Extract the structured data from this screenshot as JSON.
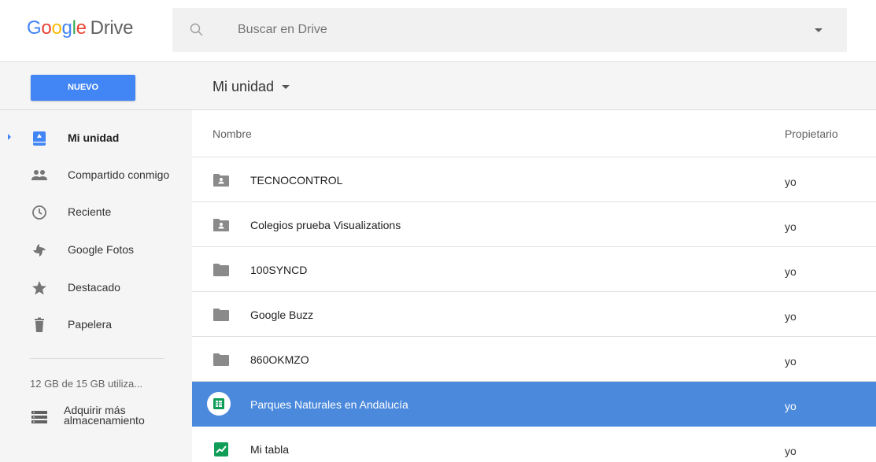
{
  "header": {
    "logo": {
      "g1": "G",
      "o1": "o",
      "o2": "o",
      "g2": "g",
      "l": "l",
      "e": "e",
      "product": "Drive"
    },
    "search_placeholder": "Buscar en Drive"
  },
  "toolbar": {
    "new_label": "NUEVO",
    "breadcrumb": "Mi unidad"
  },
  "sidebar": {
    "items": [
      {
        "label": "Mi unidad",
        "icon": "my-drive-icon",
        "active": true
      },
      {
        "label": "Compartido conmigo",
        "icon": "shared-people-icon"
      },
      {
        "label": "Reciente",
        "icon": "clock-icon"
      },
      {
        "label": "Google Fotos",
        "icon": "photos-pinwheel-icon"
      },
      {
        "label": "Destacado",
        "icon": "star-icon"
      },
      {
        "label": "Papelera",
        "icon": "trash-icon"
      }
    ],
    "storage_text": "12 GB de 15 GB utiliza...",
    "buy_storage_line1": "Adquirir más",
    "buy_storage_line2": "almacenamiento"
  },
  "list": {
    "columns": {
      "name": "Nombre",
      "owner": "Propietario"
    },
    "rows": [
      {
        "name": "TECNOCONTROL",
        "owner": "yo",
        "icon": "shared-folder-icon"
      },
      {
        "name": "Colegios prueba Visualizations",
        "owner": "yo",
        "icon": "shared-folder-icon"
      },
      {
        "name": "100SYNCD",
        "owner": "yo",
        "icon": "folder-icon"
      },
      {
        "name": "Google Buzz",
        "owner": "yo",
        "icon": "folder-icon"
      },
      {
        "name": "860OKMZO",
        "owner": "yo",
        "icon": "folder-icon"
      },
      {
        "name": "Parques Naturales en Andalucía",
        "owner": "yo",
        "icon": "spreadsheet-icon",
        "selected": true
      },
      {
        "name": "Mi tabla",
        "owner": "yo",
        "icon": "chart-icon"
      }
    ]
  },
  "colors": {
    "accent": "#4285f4",
    "selected_row": "#4a89dc",
    "sheets_green": "#0f9d58",
    "sidebar_bg": "#f5f5f5"
  }
}
